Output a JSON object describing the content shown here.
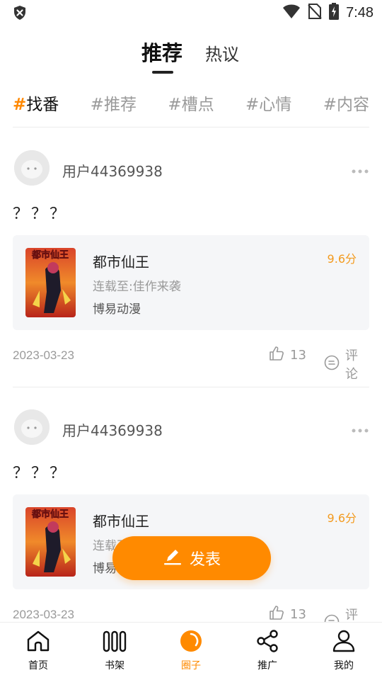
{
  "status_bar": {
    "time": "7:48"
  },
  "top_tabs": {
    "active": "推荐",
    "inactive": "热议"
  },
  "tags": [
    {
      "hash": "#",
      "label": "找番",
      "active": true
    },
    {
      "hash": "#",
      "label": "推荐",
      "active": false
    },
    {
      "hash": "#",
      "label": "槽点",
      "active": false
    },
    {
      "hash": "#",
      "label": "心情",
      "active": false
    },
    {
      "hash": "#",
      "label": "内容",
      "active": false
    }
  ],
  "posts": [
    {
      "username": "用户44369938",
      "text": "？？？",
      "book": {
        "title": "都市仙王",
        "status": "连载至:佳作来袭",
        "author": "博易动漫",
        "score": "9.6分",
        "cover_text": "都市仙王"
      },
      "date": "2023-03-23",
      "likes": "13",
      "comment_label": "评论"
    },
    {
      "username": "用户44369938",
      "text": "？？？",
      "book": {
        "title": "都市仙王",
        "status": "连载至:佳作来袭",
        "author": "博易动漫",
        "score": "9.6分",
        "cover_text": "都市仙王"
      },
      "date": "2023-03-23",
      "likes": "13",
      "comment_label": "评论"
    }
  ],
  "fab": {
    "label": "发表"
  },
  "bottom_nav": [
    {
      "label": "首页",
      "icon": "home-icon",
      "active": false
    },
    {
      "label": "书架",
      "icon": "bookshelf-icon",
      "active": false
    },
    {
      "label": "圈子",
      "icon": "circle-icon",
      "active": true
    },
    {
      "label": "推广",
      "icon": "share-icon",
      "active": false
    },
    {
      "label": "我的",
      "icon": "profile-icon",
      "active": false
    }
  ],
  "colors": {
    "accent": "#ff8a00",
    "score": "#f39a1e",
    "muted": "#9a9a9a",
    "card_bg": "#f5f6f8"
  }
}
